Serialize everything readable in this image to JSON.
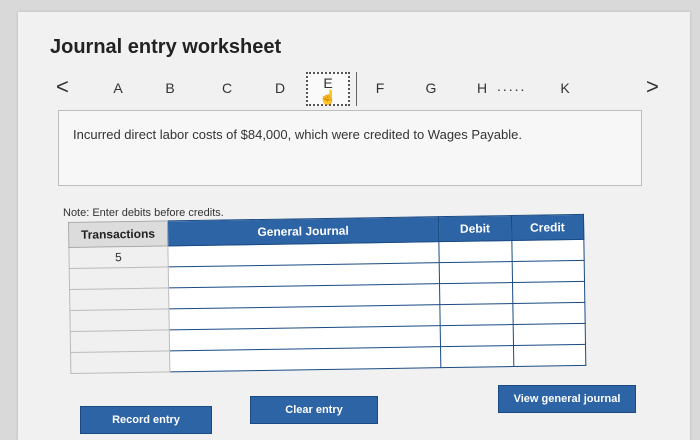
{
  "title": "Journal entry worksheet",
  "nav": {
    "prev": "<",
    "next": ">"
  },
  "tabs": [
    "A",
    "B",
    "C",
    "D",
    "E",
    "F",
    "G",
    "H",
    "K"
  ],
  "tab_ellipsis": ".....",
  "active_tab": "E",
  "description": "Incurred direct labor costs of $84,000, which were credited to Wages Payable.",
  "note": "Note: Enter debits before credits.",
  "table": {
    "headers": {
      "transactions": "Transactions",
      "general_journal": "General Journal",
      "debit": "Debit",
      "credit": "Credit"
    },
    "transaction_number": "5"
  },
  "buttons": {
    "record": "Record entry",
    "clear": "Clear entry",
    "view": "View general journal"
  },
  "colors": {
    "header": "#2c64a6",
    "button": "#2c64a6"
  }
}
